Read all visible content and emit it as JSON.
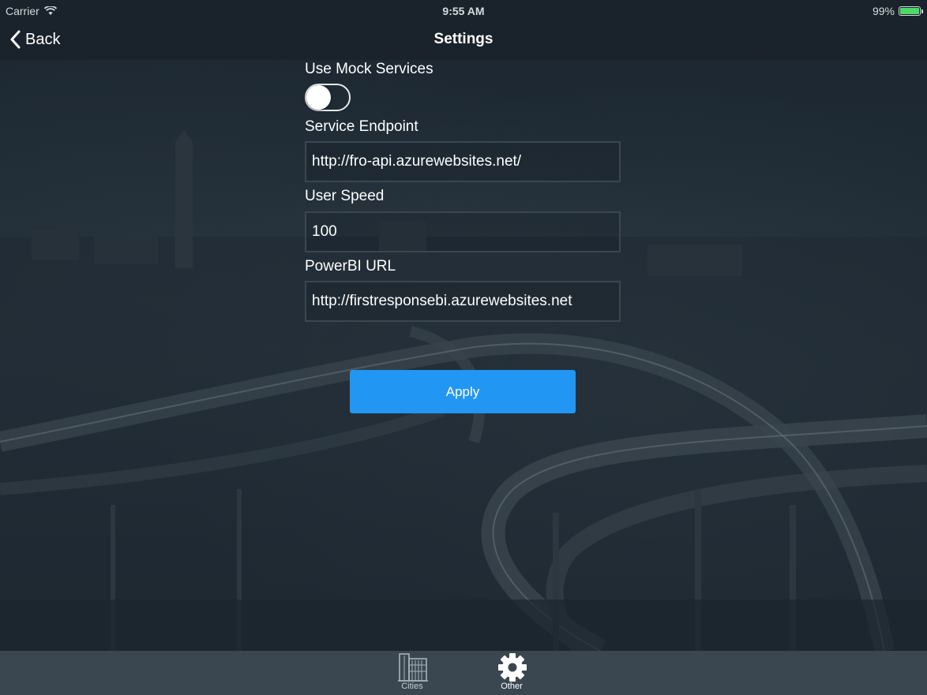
{
  "status_bar": {
    "carrier": "Carrier",
    "time": "9:55 AM",
    "battery": "99%",
    "battery_color": "#4cd964"
  },
  "nav": {
    "back_label": "Back",
    "title": "Settings"
  },
  "settings": {
    "use_mock_label": "Use Mock Services",
    "use_mock_on": false,
    "endpoint_label": "Service Endpoint",
    "endpoint_value": "http://fro-api.azurewebsites.net/",
    "speed_label": "User Speed",
    "speed_value": "100",
    "powerbi_label": "PowerBI URL",
    "powerbi_value": "http://firstresponsebi.azurewebsites.net",
    "apply_label": "Apply",
    "apply_color": "#2196f3"
  },
  "tabs": [
    {
      "label": "Cities",
      "icon": "building-icon",
      "selected": false
    },
    {
      "label": "Other",
      "icon": "gear-icon",
      "selected": true
    }
  ]
}
